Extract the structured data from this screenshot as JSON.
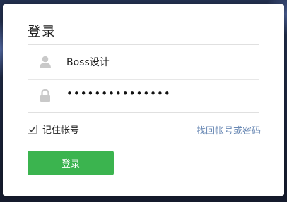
{
  "login": {
    "title": "登录",
    "username_value": "Boss设计",
    "password_mask": "•••••••••••••••",
    "remember_label": "记住帐号",
    "remember_checked": true,
    "forgot_link": "找回帐号或密码",
    "submit_label": "登录"
  },
  "icons": {
    "user": "user-icon",
    "password": "lock-icon",
    "checkbox": "checkmark-icon"
  },
  "colors": {
    "primary_button": "#3bb44f",
    "link": "#6b8ab5",
    "border": "#e0e0e0"
  }
}
